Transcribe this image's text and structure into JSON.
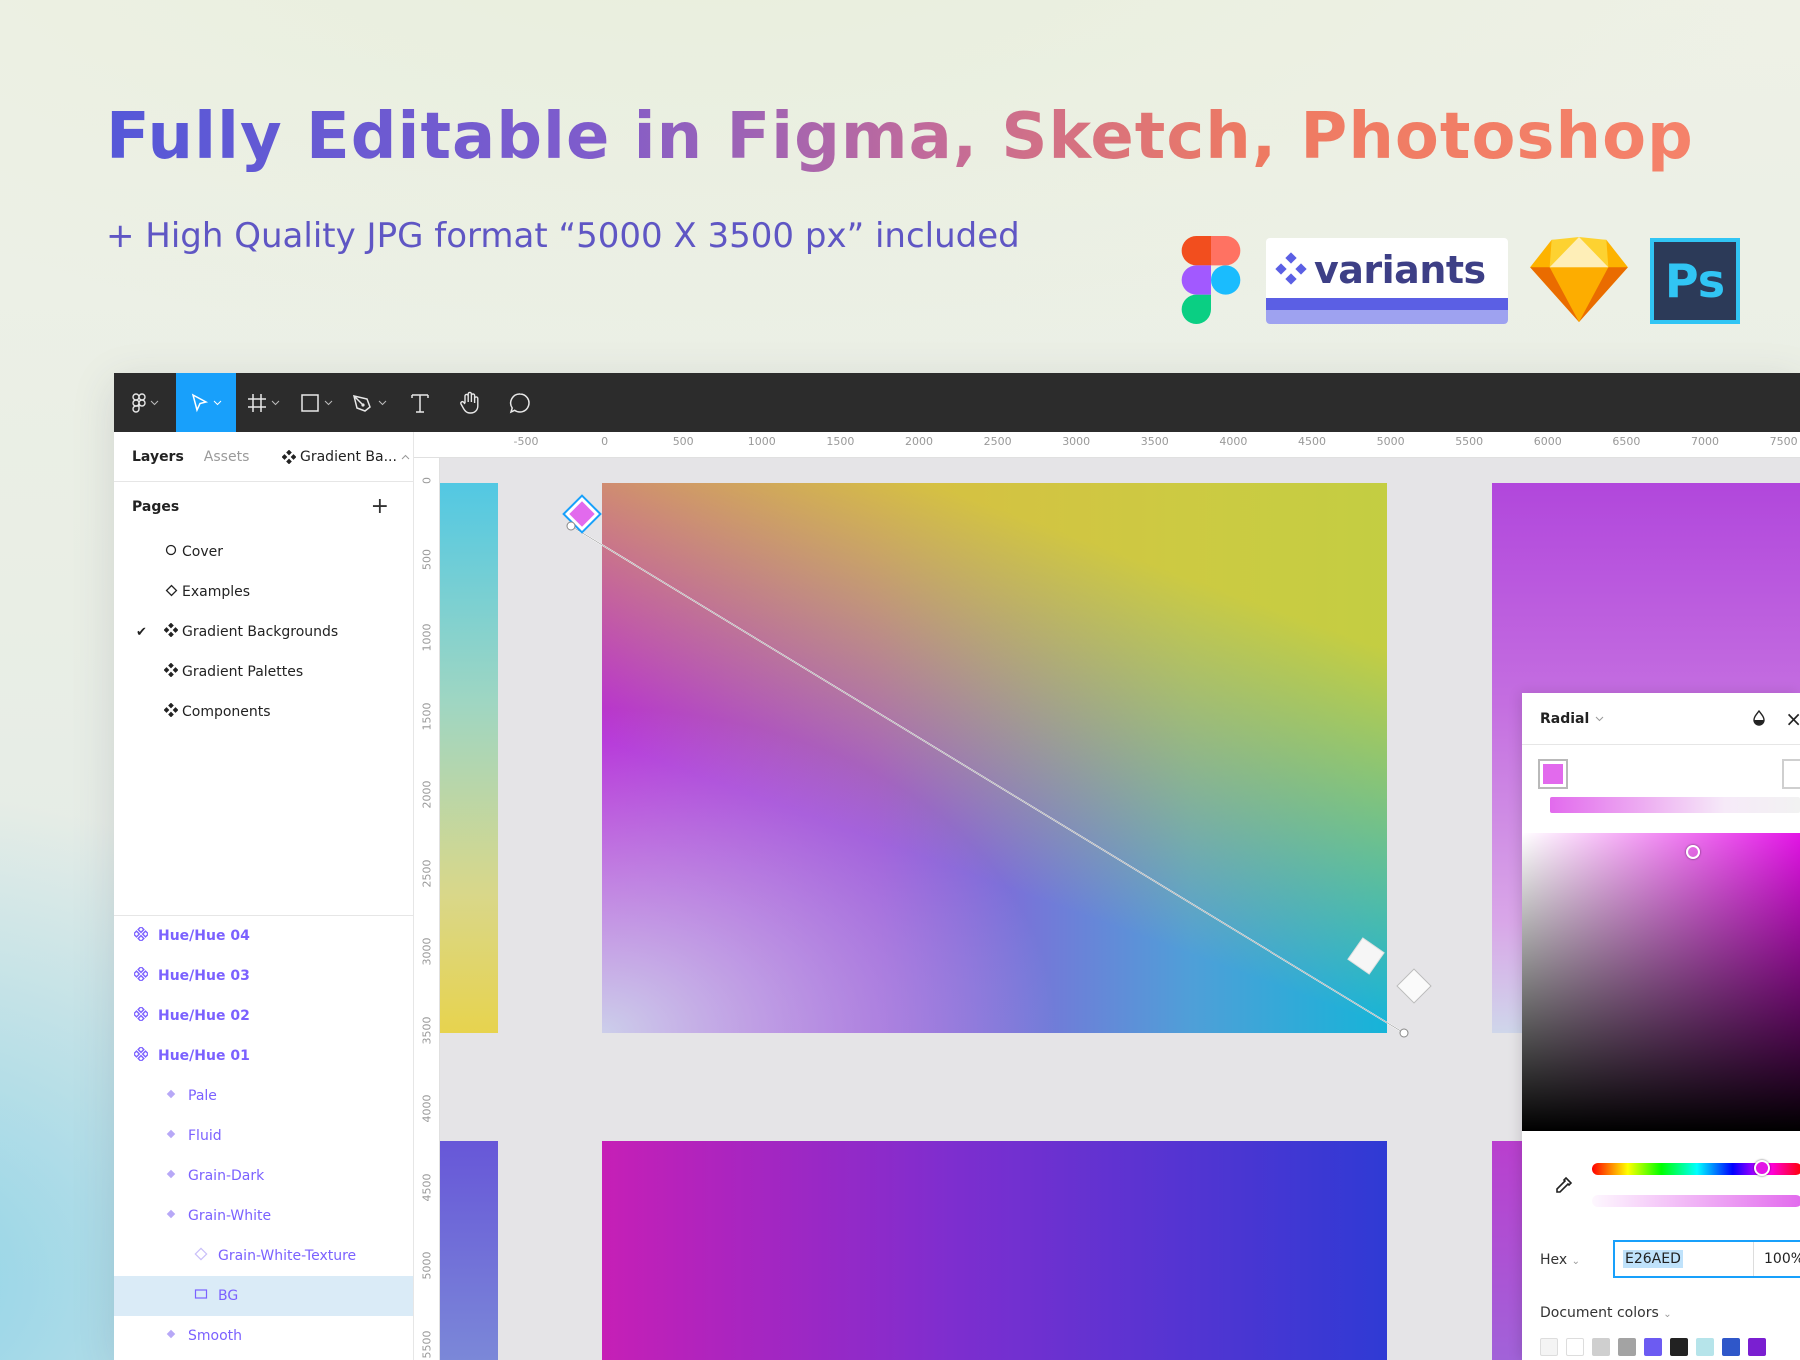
{
  "hero": {
    "headline": "Fully Editable in Figma, Sketch, Photoshop",
    "subline": "+ High Quality JPG format “5000 X 3500 px” included"
  },
  "logos": {
    "variants_text": "variants",
    "ps_text": "Ps"
  },
  "toolbar": {
    "icons": [
      "figma-menu-icon",
      "move-tool-icon",
      "frame-tool-icon",
      "rectangle-tool-icon",
      "pen-tool-icon",
      "text-tool-icon",
      "hand-tool-icon",
      "comment-tool-icon"
    ],
    "active": "move-tool-icon",
    "accent": "#18a0fb"
  },
  "left_panel": {
    "tabs": [
      "Layers",
      "Assets"
    ],
    "active_tab": "Layers",
    "page_selector": "Gradient Ba...",
    "pages_title": "Pages",
    "pages": [
      {
        "label": "Cover",
        "icon": "circle"
      },
      {
        "label": "Examples",
        "icon": "diamond"
      },
      {
        "label": "Gradient Backgrounds",
        "icon": "component",
        "checked": true
      },
      {
        "label": "Gradient Palettes",
        "icon": "component"
      },
      {
        "label": "Components",
        "icon": "component"
      }
    ],
    "layers": [
      {
        "label": "Hue/Hue 04",
        "type": "component",
        "bold": true
      },
      {
        "label": "Hue/Hue 03",
        "type": "component",
        "bold": true
      },
      {
        "label": "Hue/Hue 02",
        "type": "component",
        "bold": true
      },
      {
        "label": "Hue/Hue 01",
        "type": "component",
        "bold": true
      },
      {
        "label": "Pale",
        "type": "instance"
      },
      {
        "label": "Fluid",
        "type": "instance"
      },
      {
        "label": "Grain-Dark",
        "type": "instance"
      },
      {
        "label": "Grain-White",
        "type": "instance"
      },
      {
        "label": "Grain-White-Texture",
        "type": "instance-outline"
      },
      {
        "label": "BG",
        "type": "rect",
        "selected": true
      },
      {
        "label": "Smooth",
        "type": "instance"
      }
    ]
  },
  "rulers": {
    "top": [
      "-500",
      "0",
      "500",
      "1000",
      "1500",
      "2000",
      "2500",
      "3000",
      "3500",
      "4000",
      "4500",
      "5000",
      "5500",
      "6000",
      "6500",
      "7000",
      "7500"
    ],
    "left": [
      "0",
      "500",
      "1000",
      "1500",
      "2000",
      "2500",
      "3000",
      "3500",
      "4000",
      "4500",
      "5000",
      "5500"
    ]
  },
  "color_picker": {
    "mode": "Radial",
    "hex_label": "Hex",
    "hex_value": "E26AED",
    "opacity": "100%",
    "doc_colors_label": "Document colors",
    "swatches": [
      "#f4f4f4",
      "#ffffff",
      "#cfcfcf",
      "#a3a3a3",
      "#6c5bf2",
      "#222222",
      "#b6e4ea",
      "#2f57c9",
      "#7a1fd1"
    ]
  }
}
